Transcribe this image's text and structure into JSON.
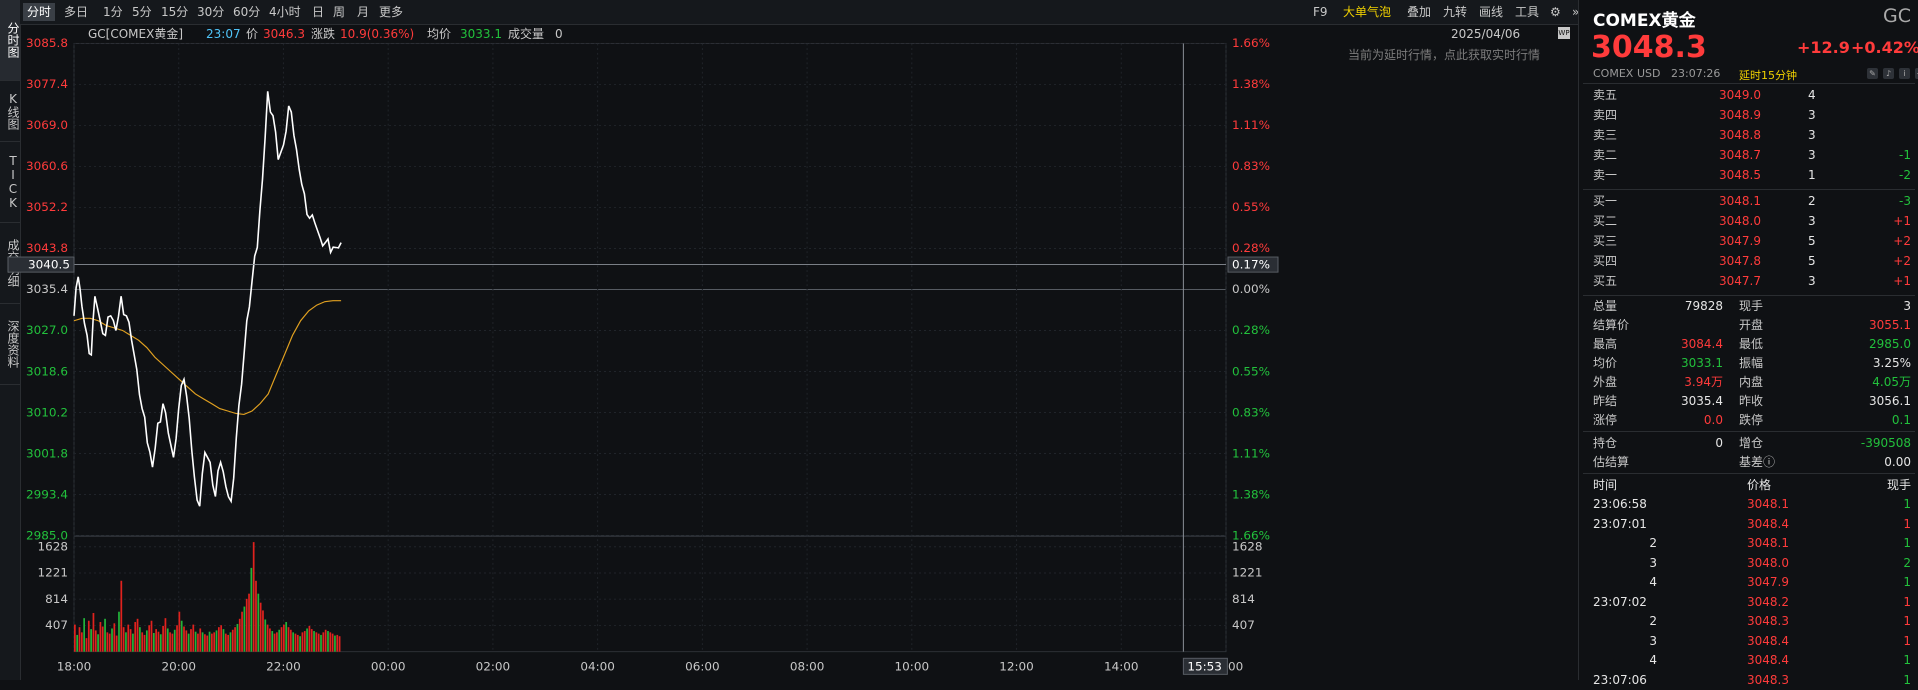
{
  "sidebar_tabs": [
    {
      "label": "分时图"
    },
    {
      "label": "K线图"
    },
    {
      "label": "TICK"
    },
    {
      "label": "成交明细"
    },
    {
      "label": "深度资料"
    }
  ],
  "period_tabs": [
    "分时",
    "多日",
    "1分",
    "5分",
    "15分",
    "30分",
    "60分",
    "4小时",
    "日",
    "周",
    "月",
    "更多"
  ],
  "right_tools": [
    "F9",
    "大单气泡",
    "叠加",
    "九转",
    "画线",
    "工具"
  ],
  "info": {
    "symbol": "GC[COMEX黄金]",
    "time": "23:07",
    "price_label": "价",
    "price": "3046.3",
    "change_label": "涨跌",
    "change": "10.9(0.36%)",
    "avg_label": "均价",
    "avg": "3033.1",
    "vol_label": "成交量",
    "vol": "0",
    "date": "2025/04/06"
  },
  "notice": "当前为延时行情，点此获取实时行情",
  "chart_data": {
    "type": "line",
    "price_ticks": [
      "3085.8",
      "3077.4",
      "3069.0",
      "3060.6",
      "3052.2",
      "3043.8",
      "3035.4",
      "3027.0",
      "3018.6",
      "3010.2",
      "3001.8",
      "2993.4",
      "2985.0"
    ],
    "pct_ticks": [
      "1.66%",
      "1.38%",
      "1.11%",
      "0.83%",
      "0.55%",
      "0.28%",
      "0.00%",
      "0.28%",
      "0.55%",
      "0.83%",
      "1.11%",
      "1.38%",
      "1.66%"
    ],
    "vol_ticks": [
      "1628",
      "1221",
      "814",
      "407"
    ],
    "time_ticks": [
      "18:00",
      "20:00",
      "22:00",
      "00:00",
      "02:00",
      "04:00",
      "06:00",
      "08:00",
      "10:00",
      "12:00",
      "14:00",
      "16:00"
    ],
    "crosshair_price": "3040.5",
    "crosshair_pct": "0.17%",
    "crosshair_time": "15:53",
    "ylim": [
      2985.0,
      3085.8
    ],
    "prev_close": 3035.4,
    "price_series_x_hours": [
      18.0,
      18.08,
      18.15,
      18.25,
      18.33,
      18.4,
      18.5,
      18.6,
      18.7,
      18.8,
      18.9,
      19.0,
      19.1,
      19.2,
      19.3,
      19.4,
      19.5,
      19.6,
      19.7,
      19.8,
      19.9,
      20.0,
      20.1,
      20.2,
      20.3,
      20.4,
      20.5,
      20.6,
      20.7,
      20.8,
      20.9,
      21.0,
      21.1,
      21.2,
      21.3,
      21.4,
      21.5,
      21.6,
      21.7,
      21.8,
      21.9,
      22.0,
      22.1,
      22.2,
      22.3,
      22.4,
      22.5,
      22.6,
      22.7,
      22.8,
      22.9,
      23.0,
      23.1
    ],
    "price_series": [
      3030,
      3038,
      3032,
      3026,
      3022,
      3034,
      3029,
      3026,
      3030,
      3027,
      3034,
      3030,
      3025,
      3019,
      3011,
      3004,
      2999,
      3008,
      3012,
      3006,
      3001,
      3011,
      3017,
      3009,
      2997,
      2991,
      3002,
      3000,
      2993,
      3000,
      2995,
      2992,
      3005,
      3016,
      3029,
      3037,
      3044,
      3058,
      3076,
      3071,
      3062,
      3065,
      3073,
      3067,
      3060,
      3055,
      3050,
      3049,
      3046,
      3045,
      3043,
      3044,
      3045
    ],
    "avg_series": [
      3029,
      3029.5,
      3029.5,
      3029,
      3028,
      3027.5,
      3027,
      3026,
      3025,
      3023.5,
      3021.5,
      3020,
      3018.5,
      3017,
      3015.5,
      3014,
      3013,
      3012,
      3011,
      3010.5,
      3010,
      3009.8,
      3010.5,
      3012,
      3014,
      3018,
      3022,
      3026,
      3029,
      3031,
      3032.2,
      3032.9,
      3033.1,
      3033.1
    ],
    "volume_bars": [
      420,
      260,
      380,
      300,
      520,
      210,
      480,
      350,
      600,
      330,
      270,
      460,
      390,
      510,
      300,
      280,
      360,
      440,
      250,
      620,
      1100,
      380,
      300,
      420,
      350,
      280,
      460,
      510,
      380,
      300,
      260,
      330,
      410,
      480,
      290,
      350,
      310,
      270,
      400,
      520,
      360,
      300,
      280,
      340,
      410,
      620,
      480,
      390,
      330,
      280,
      350,
      420,
      310,
      280,
      360,
      300,
      270,
      250,
      310,
      280,
      300,
      330,
      380,
      410,
      350,
      280,
      260,
      300,
      340,
      380,
      430,
      510,
      620,
      700,
      820,
      900,
      1300,
      1700,
      1100,
      900,
      760,
      640,
      500,
      420,
      360,
      320,
      280,
      300,
      340,
      380,
      420,
      460,
      380,
      340,
      300,
      280,
      260,
      240,
      300,
      320,
      360,
      400,
      350,
      320,
      300,
      280,
      260,
      300,
      340,
      320,
      300,
      280,
      250,
      260,
      240
    ],
    "volume_max": 1700
  },
  "quote": {
    "title": "COMEX黄金",
    "code": "GC",
    "price": "3048.3",
    "chg": "+12.9",
    "chg_pct": "+0.42%",
    "exchange": "COMEX",
    "currency": "USD",
    "time": "23:07:26",
    "delay": "延时15分钟"
  },
  "sell_orders": [
    {
      "label": "卖五",
      "price": "3049.0",
      "qty": "4",
      "chg": ""
    },
    {
      "label": "卖四",
      "price": "3048.9",
      "qty": "3",
      "chg": ""
    },
    {
      "label": "卖三",
      "price": "3048.8",
      "qty": "3",
      "chg": ""
    },
    {
      "label": "卖二",
      "price": "3048.7",
      "qty": "3",
      "chg": "-1"
    },
    {
      "label": "卖一",
      "price": "3048.5",
      "qty": "1",
      "chg": "-2"
    }
  ],
  "buy_orders": [
    {
      "label": "买一",
      "price": "3048.1",
      "qty": "2",
      "chg": "-3"
    },
    {
      "label": "买二",
      "price": "3048.0",
      "qty": "3",
      "chg": "+1"
    },
    {
      "label": "买三",
      "price": "3047.9",
      "qty": "5",
      "chg": "+2"
    },
    {
      "label": "买四",
      "price": "3047.8",
      "qty": "5",
      "chg": "+2"
    },
    {
      "label": "买五",
      "price": "3047.7",
      "qty": "3",
      "chg": "+1"
    }
  ],
  "stats": [
    {
      "l1": "总量",
      "v1": "79828",
      "c1": "white",
      "l2": "现手",
      "v2": "3",
      "c2": "white"
    },
    {
      "l1": "结算价",
      "v1": "",
      "c1": "white",
      "l2": "开盘",
      "v2": "3055.1",
      "c2": "red"
    },
    {
      "l1": "最高",
      "v1": "3084.4",
      "c1": "red",
      "l2": "最低",
      "v2": "2985.0",
      "c2": "green"
    },
    {
      "l1": "均价",
      "v1": "3033.1",
      "c1": "green",
      "l2": "振幅",
      "v2": "3.25%",
      "c2": "white"
    },
    {
      "l1": "外盘",
      "v1": "3.94万",
      "c1": "red",
      "l2": "内盘",
      "v2": "4.05万",
      "c2": "green"
    },
    {
      "l1": "昨结",
      "v1": "3035.4",
      "c1": "white",
      "l2": "昨收",
      "v2": "3056.1",
      "c2": "white"
    },
    {
      "l1": "涨停",
      "v1": "0.0",
      "c1": "red",
      "l2": "跌停",
      "v2": "0.1",
      "c2": "green"
    }
  ],
  "stats2": [
    {
      "l1": "持仓",
      "v1": "0",
      "c1": "white",
      "l2": "增仓",
      "v2": "-390508",
      "c2": "green"
    },
    {
      "l1": "估结算",
      "v1": "",
      "c1": "white",
      "l2": "基差ⓘ",
      "v2": "0.00",
      "c2": "white"
    }
  ],
  "ticks_header": {
    "time": "时间",
    "price": "价格",
    "qty": "现手"
  },
  "ticks": [
    {
      "time": "23:06:58",
      "price": "3048.1",
      "qty": "1",
      "qc": "green"
    },
    {
      "time": "23:07:01",
      "price": "3048.4",
      "qty": "1",
      "qc": "red"
    },
    {
      "time": "2",
      "price": "3048.1",
      "qty": "1",
      "qc": "green"
    },
    {
      "time": "3",
      "price": "3048.0",
      "qty": "2",
      "qc": "green"
    },
    {
      "time": "4",
      "price": "3047.9",
      "qty": "1",
      "qc": "green"
    },
    {
      "time": "23:07:02",
      "price": "3048.2",
      "qty": "1",
      "qc": "red"
    },
    {
      "time": "2",
      "price": "3048.3",
      "qty": "1",
      "qc": "red"
    },
    {
      "time": "3",
      "price": "3048.4",
      "qty": "1",
      "qc": "red"
    },
    {
      "time": "4",
      "price": "3048.4",
      "qty": "1",
      "qc": "green"
    },
    {
      "time": "23:07:06",
      "price": "3048.3",
      "qty": "1",
      "qc": "green"
    }
  ]
}
